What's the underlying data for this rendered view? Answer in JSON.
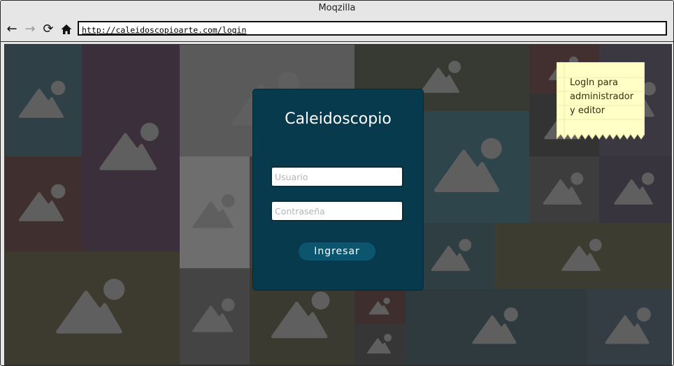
{
  "browser": {
    "title": "Moqzilla",
    "url": "http://caleidoscopioarte.com/login",
    "nav": {
      "back_icon": "back-arrow-icon",
      "forward_icon": "forward-arrow-icon",
      "reload_icon": "reload-icon",
      "home_icon": "home-icon"
    }
  },
  "login": {
    "title": "Caleidoscopio",
    "username_placeholder": "Usuario",
    "password_placeholder": "Contraseña",
    "submit_label": "Ingresar"
  },
  "note": {
    "lines": [
      "LogIn para",
      "administrador",
      "y editor"
    ]
  },
  "colors": {
    "dialog": "#073a4d",
    "button": "#0b566e",
    "note": "#ffffc6",
    "image_glyph": "#5f5f5f"
  }
}
